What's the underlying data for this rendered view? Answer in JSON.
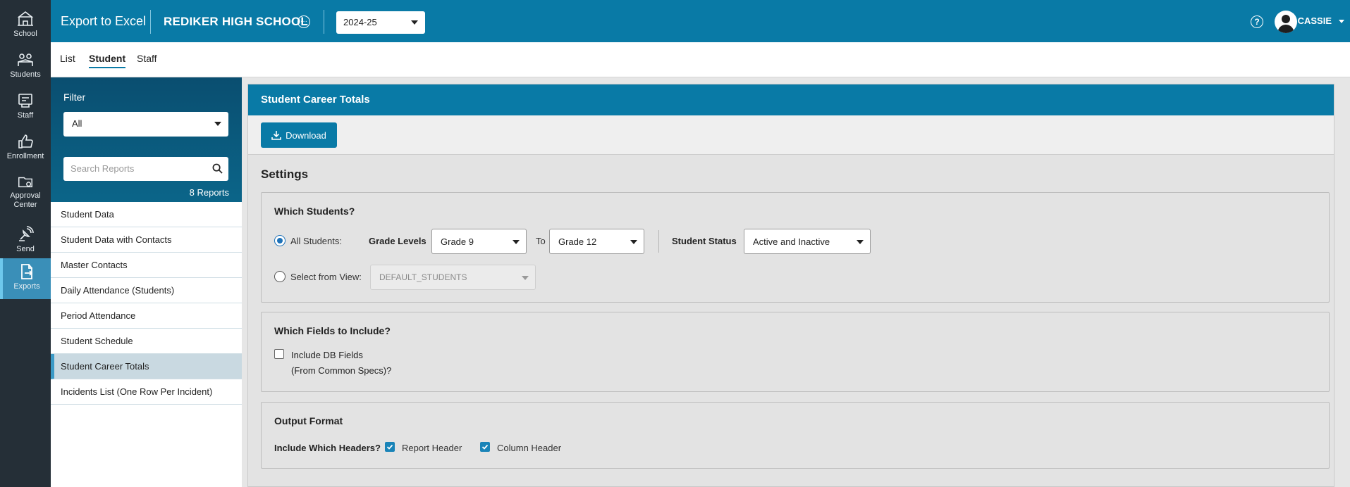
{
  "rail": {
    "items": [
      {
        "label": "School",
        "icon": "school-icon"
      },
      {
        "label": "Students",
        "icon": "students-icon"
      },
      {
        "label": "Staff",
        "icon": "staff-icon"
      },
      {
        "label": "Enrollment",
        "icon": "thumbs-up-icon"
      },
      {
        "label": "Approval Center",
        "icon": "folder-gear-icon"
      },
      {
        "label": "Send",
        "icon": "satellite-icon"
      },
      {
        "label": "Exports",
        "icon": "export-icon"
      }
    ]
  },
  "header": {
    "app_title": "Export to Excel",
    "school_name": "REDIKER HIGH SCHOOL",
    "school_more": "···",
    "year": "2024-25",
    "help": "?",
    "user": "CASSIE"
  },
  "subnav": {
    "tabs": [
      "List",
      "Student",
      "Staff"
    ],
    "active": "Student"
  },
  "sidebar": {
    "filter_label": "Filter",
    "filter_value": "All",
    "search_placeholder": "Search Reports",
    "count": "8 Reports",
    "reports": [
      "Student Data",
      "Student Data with Contacts",
      "Master Contacts",
      "Daily Attendance (Students)",
      "Period Attendance",
      "Student Schedule",
      "Student Career Totals",
      "Incidents List (One Row Per Incident)"
    ],
    "active_report": "Student Career Totals"
  },
  "main": {
    "title": "Student Career Totals",
    "download_label": "Download",
    "settings_title": "Settings",
    "which_students": {
      "title": "Which Students?",
      "all_students_label": "All Students:",
      "grade_levels_label": "Grade Levels",
      "grade_from": "Grade 9",
      "to_label": "To",
      "grade_to": "Grade 12",
      "status_label": "Student Status",
      "status_value": "Active and Inactive",
      "select_view_label": "Select from View:",
      "view_value": "DEFAULT_STUDENTS"
    },
    "which_fields": {
      "title": "Which Fields to Include?",
      "include_db_line1": "Include DB Fields",
      "include_db_line2": "(From Common Specs)?"
    },
    "output_format": {
      "title": "Output Format",
      "headers_label": "Include Which Headers?",
      "report_header_label": "Report Header",
      "column_header_label": "Column Header"
    }
  },
  "colors": {
    "brand_blue": "#097aa6",
    "rail_bg": "#252f37",
    "sidebar_head": "#0b5a7e",
    "active_accent": "#3b9ac6"
  }
}
